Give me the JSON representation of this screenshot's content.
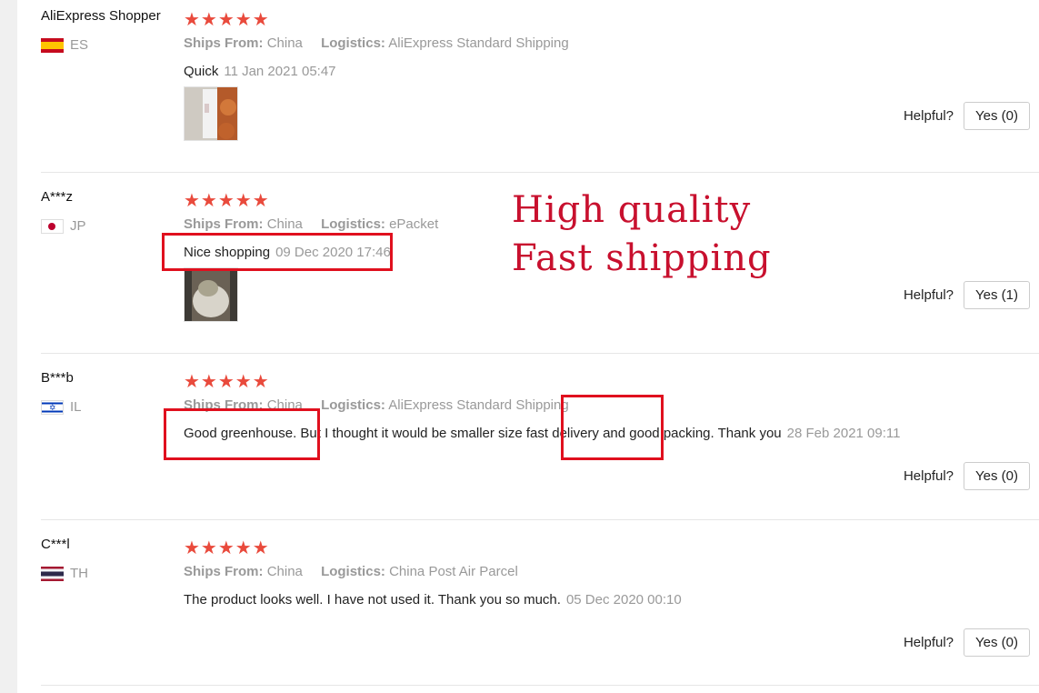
{
  "labels": {
    "ships_from": "Ships From:",
    "logistics": "Logistics:",
    "helpful": "Helpful?"
  },
  "overlay": {
    "line1": "High quality",
    "line2": "Fast shipping"
  },
  "colors": {
    "star": "#e94a3c",
    "annotation": "#e0101e",
    "muted": "#999999"
  },
  "reviews": [
    {
      "user": "AliExpress Shopper",
      "country": "ES",
      "rating": 5,
      "stars": "★★★★★",
      "ships_from": "China",
      "logistics": "AliExpress Standard Shipping",
      "text": "Quick",
      "date": "11 Jan 2021 05:47",
      "has_photo": true,
      "yes_label": "Yes (0)"
    },
    {
      "user": "A***z",
      "country": "JP",
      "rating": 5,
      "stars": "★★★★★",
      "ships_from": "China",
      "logistics": "ePacket",
      "text": "Nice shopping",
      "date": "09 Dec 2020 17:46",
      "has_photo": true,
      "yes_label": "Yes (1)"
    },
    {
      "user": "B***b",
      "country": "IL",
      "rating": 5,
      "stars": "★★★★★",
      "ships_from": "China",
      "logistics": "AliExpress Standard Shipping",
      "text": "Good greenhouse. But I thought it would be smaller size fast delivery and good packing. Thank you",
      "date": "28 Feb 2021 09:11",
      "has_photo": false,
      "yes_label": "Yes (0)"
    },
    {
      "user": "C***l",
      "country": "TH",
      "rating": 5,
      "stars": "★★★★★",
      "ships_from": "China",
      "logistics": "China Post Air Parcel",
      "text": "The product looks well. I have not used it. Thank you so much.",
      "date": "05 Dec 2020 00:10",
      "has_photo": false,
      "yes_label": "Yes (0)"
    }
  ]
}
